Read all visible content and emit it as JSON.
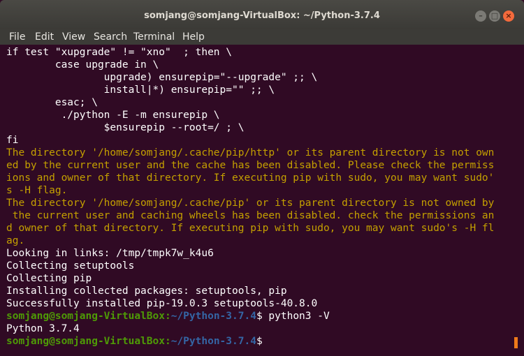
{
  "window": {
    "title": "somjang@somjang-VirtualBox: ~/Python-3.7.4",
    "controls": {
      "minimize": "–",
      "maximize": "□",
      "close": "×"
    }
  },
  "menubar": {
    "items": [
      "File",
      "Edit",
      "View",
      "Search",
      "Terminal",
      "Help"
    ]
  },
  "terminal": {
    "lines": [
      "if test \"xupgrade\" != \"xno\"  ; then \\",
      "        case upgrade in \\",
      "                upgrade) ensurepip=\"--upgrade\" ;; \\",
      "                install|*) ensurepip=\"\" ;; \\",
      "        esac; \\",
      "         ./python -E -m ensurepip \\",
      "                $ensurepip --root=/ ; \\",
      "fi",
      "The directory '/home/somjang/.cache/pip/http' or its parent directory is not own",
      "ed by the current user and the cache has been disabled. Please check the permiss",
      "ions and owner of that directory. If executing pip with sudo, you may want sudo'",
      "s -H flag.",
      "The directory '/home/somjang/.cache/pip' or its parent directory is not owned by",
      " the current user and caching wheels has been disabled. check the permissions an",
      "d owner of that directory. If executing pip with sudo, you may want sudo's -H fl",
      "ag.",
      "Looking in links: /tmp/tmpk7w_k4u6",
      "Collecting setuptools",
      "Collecting pip",
      "Installing collected packages: setuptools, pip",
      "Successfully installed pip-19.0.3 setuptools-40.8.0"
    ],
    "prompt_user_host": "somjang@somjang-VirtualBox",
    "prompt_sep": ":",
    "prompt_path": "~/Python-3.7.4",
    "prompt_symbol": "$",
    "command": " python3 -V",
    "output": "Python 3.7.4"
  },
  "colors": {
    "background": "#300a24",
    "text": "#ffffff",
    "warning": "#c4a000",
    "prompt_user": "#4e9a06",
    "prompt_path": "#3465a4",
    "cursor": "#ef7a1a"
  }
}
